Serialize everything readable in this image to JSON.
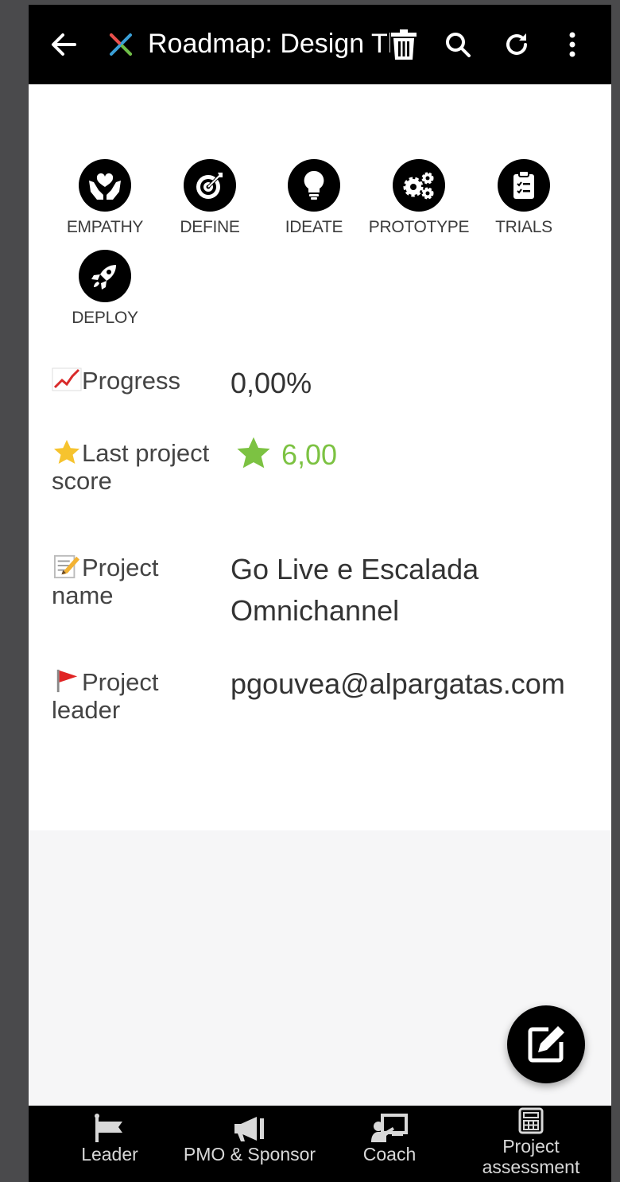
{
  "header": {
    "title": "Roadmap: Design Thinking",
    "back_icon": "arrow-left-icon",
    "app_icon": "colorful-x-logo-icon",
    "actions": [
      "trash-icon",
      "search-icon",
      "refresh-icon",
      "more-vertical-icon"
    ]
  },
  "phases": [
    {
      "label": "EMPATHY",
      "icon": "heart-hands-icon"
    },
    {
      "label": "DEFINE",
      "icon": "target-icon"
    },
    {
      "label": "IDEATE",
      "icon": "lightbulb-icon"
    },
    {
      "label": "PROTOTYPE",
      "icon": "gears-icon"
    },
    {
      "label": "TRIALS",
      "icon": "clipboard-icon"
    },
    {
      "label": "DEPLOY",
      "icon": "rocket-icon"
    }
  ],
  "fields": {
    "progress": {
      "label": "Progress",
      "value": "0,00%"
    },
    "score": {
      "label": "Last project score",
      "value": "6,00",
      "accent": "#7cc242"
    },
    "name": {
      "label": "Project name",
      "value": "Go Live e Escalada Omnichannel"
    },
    "leader": {
      "label": "Project leader",
      "value": "pgouvea@alpargatas.com"
    }
  },
  "fab": {
    "icon": "edit-icon"
  },
  "bottom_nav": [
    {
      "label": "Leader",
      "icon": "flag-icon"
    },
    {
      "label": "PMO & Sponsor",
      "icon": "megaphone-icon"
    },
    {
      "label": "Coach",
      "icon": "presenter-icon"
    },
    {
      "label": "Project assessment",
      "icon": "calculator-icon"
    }
  ]
}
